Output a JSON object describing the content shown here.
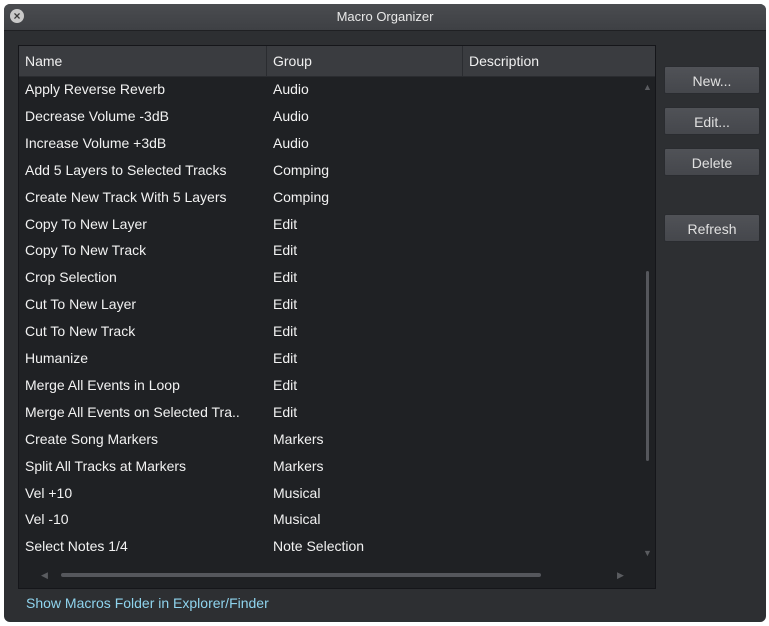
{
  "window": {
    "title": "Macro Organizer"
  },
  "table": {
    "columns": [
      "Name",
      "Group",
      "Description"
    ],
    "rows": [
      {
        "name": "Apply Reverse Reverb",
        "group": "Audio",
        "description": ""
      },
      {
        "name": "Decrease Volume -3dB",
        "group": "Audio",
        "description": ""
      },
      {
        "name": "Increase Volume +3dB",
        "group": "Audio",
        "description": ""
      },
      {
        "name": "Add 5 Layers to Selected Tracks",
        "group": "Comping",
        "description": ""
      },
      {
        "name": "Create New Track With 5 Layers",
        "group": "Comping",
        "description": ""
      },
      {
        "name": "Copy To New Layer",
        "group": "Edit",
        "description": ""
      },
      {
        "name": "Copy To New Track",
        "group": "Edit",
        "description": ""
      },
      {
        "name": "Crop Selection",
        "group": "Edit",
        "description": ""
      },
      {
        "name": "Cut To New Layer",
        "group": "Edit",
        "description": ""
      },
      {
        "name": "Cut To New Track",
        "group": "Edit",
        "description": ""
      },
      {
        "name": "Humanize",
        "group": "Edit",
        "description": ""
      },
      {
        "name": "Merge All Events in Loop",
        "group": "Edit",
        "description": ""
      },
      {
        "name": "Merge All Events on Selected Tra..",
        "group": "Edit",
        "description": ""
      },
      {
        "name": "Create Song Markers",
        "group": "Markers",
        "description": ""
      },
      {
        "name": "Split All Tracks at Markers",
        "group": "Markers",
        "description": ""
      },
      {
        "name": "Vel +10",
        "group": "Musical",
        "description": ""
      },
      {
        "name": "Vel -10",
        "group": "Musical",
        "description": ""
      },
      {
        "name": "Select Notes 1/4",
        "group": "Note Selection",
        "description": ""
      }
    ]
  },
  "buttons": {
    "new": "New...",
    "edit": "Edit...",
    "delete": "Delete",
    "refresh": "Refresh"
  },
  "footer": {
    "link": "Show Macros Folder in Explorer/Finder"
  },
  "icons": {
    "close": "close-icon",
    "scroll_up": "arrow-up-icon",
    "scroll_down": "arrow-down-icon",
    "scroll_left": "arrow-left-icon",
    "scroll_right": "arrow-right-icon"
  }
}
